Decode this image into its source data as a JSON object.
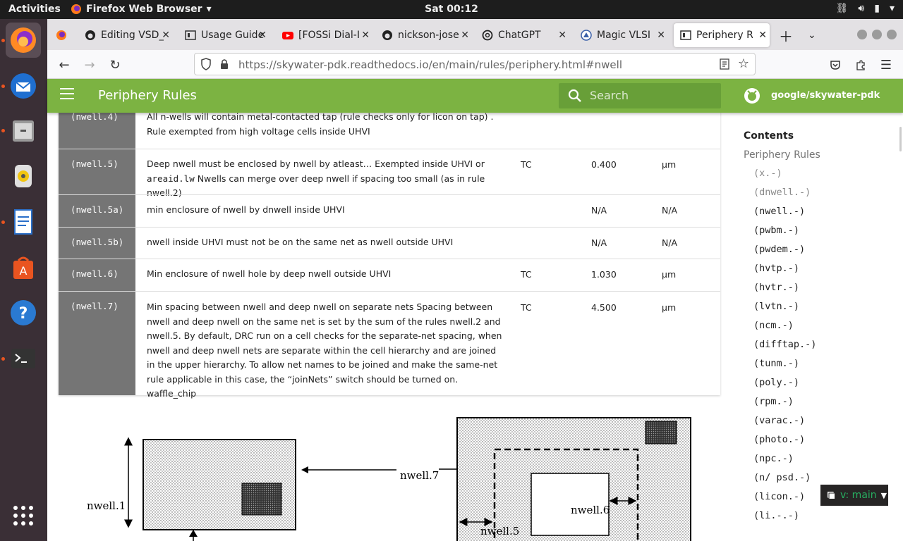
{
  "topbar": {
    "activities": "Activities",
    "app_name": "Firefox Web Browser",
    "clock": "Sat 00:12"
  },
  "tabs": [
    {
      "label": "Editing VSD_",
      "icon": "github-icon"
    },
    {
      "label": "Usage Guide",
      "icon": "doc-icon"
    },
    {
      "label": "[FOSSi Dial-I",
      "icon": "youtube-icon"
    },
    {
      "label": "nickson-jose",
      "icon": "github-icon"
    },
    {
      "label": "ChatGPT",
      "icon": "chatgpt-icon"
    },
    {
      "label": "Magic VLSI",
      "icon": "magic-icon"
    },
    {
      "label": "Periphery Ru",
      "icon": "doc-icon",
      "current": true
    }
  ],
  "navbar": {
    "url_host": "https://skywater-pdk.readthedocs.io",
    "url_path": "/en/main/rules/periphery.html#nwell"
  },
  "header": {
    "title": "Periphery Rules",
    "search_placeholder": "Search",
    "repo": "google/skywater-pdk"
  },
  "rules": [
    {
      "id": "(nwell.4)",
      "desc": "All n-wells will contain metal-contacted tap (rule checks only for licon on tap) . Rule exempted from high voltage cells inside UHVI",
      "flag": "",
      "value": "",
      "unit": ""
    },
    {
      "id": "(nwell.5)",
      "desc_a": "Deep nwell must be enclosed by nwell by atleast… Exempted inside UHVI or ",
      "desc_code": "areaid.lw",
      "desc_b": " Nwells can merge over deep nwell if spacing too small (as in rule nwell.2)",
      "flag": "TC",
      "value": "0.400",
      "unit": "µm"
    },
    {
      "id": "(nwell.5a)",
      "desc": "min enclosure of nwell by dnwell inside UHVI",
      "flag": "",
      "value": "N/A",
      "unit": "N/A"
    },
    {
      "id": "(nwell.5b)",
      "desc": "nwell inside UHVI must not be on the same net as nwell outside UHVI",
      "flag": "",
      "value": "N/A",
      "unit": "N/A"
    },
    {
      "id": "(nwell.6)",
      "desc": "Min enclosure of nwell hole by deep nwell outside UHVI",
      "flag": "TC",
      "value": "1.030",
      "unit": "µm"
    },
    {
      "id": "(nwell.7)",
      "desc": "Min spacing between nwell and deep nwell on separate nets Spacing between nwell and deep nwell on the same net is set by the sum of the rules nwell.2 and nwell.5. By default, DRC run on a cell checks for the separate-net spacing, when nwell and deep nwell nets are separate within the cell hierarchy and are joined in the upper hierarchy. To allow net names to be joined and make the same-net rule applicable in this case, the “joinNets” switch should be turned on. waffle_chip",
      "flag": "TC",
      "value": "4.500",
      "unit": "µm"
    }
  ],
  "diagram": {
    "label_nwell1": "nwell.1",
    "label_nwell7": "nwell.7",
    "label_nwell6": "nwell.6",
    "label_nwell5": "nwell.5"
  },
  "toc": {
    "title": "Contents",
    "root": "Periphery Rules",
    "items": [
      "(x.-)",
      "(dnwell.-)",
      "(nwell.-)",
      "(pwbm.-)",
      "(pwdem.-)",
      "(hvtp.-)",
      "(hvtr.-)",
      "(lvtn.-)",
      "(ncm.-)",
      "(difftap.-)",
      "(tunm.-)",
      "(poly.-)",
      "(rpm.-)",
      "(varac.-)",
      "(photo.-)",
      "(npc.-)",
      "(n/ psd.-)",
      "(licon.-)",
      "(li.-.-)"
    ]
  },
  "version": {
    "label": "v: main"
  },
  "colors": {
    "header_green": "#7cb342",
    "search_green": "#689f38",
    "id_gray": "#757575",
    "dock": "#3a2f36"
  }
}
